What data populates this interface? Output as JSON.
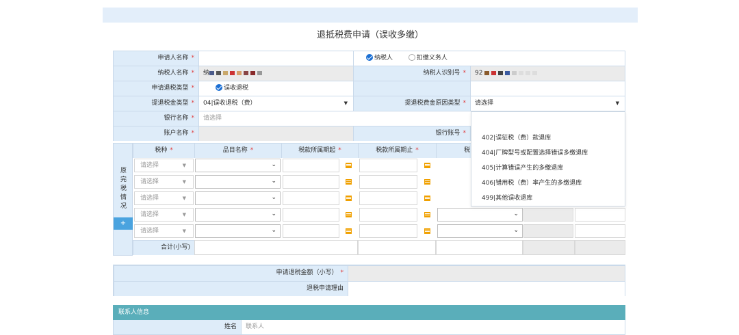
{
  "page_title": "退抵税费申请（误收多缴）",
  "form": {
    "applicant_name_label": "申请人名称",
    "applicant_type_options": [
      "纳税人",
      "扣缴义务人"
    ],
    "taxpayer_name_label": "纳税人名称",
    "taxpayer_name_masked": "纳",
    "taxpayer_id_label": "纳税人识别号",
    "taxpayer_id_masked": "92",
    "refund_type_label": "申请退税类型",
    "refund_type_value": "误收退税",
    "amount_type_label": "提退税金类型",
    "amount_type_value": "04|误收退税（费）",
    "reason_type_label": "提退税费金原因类型",
    "reason_type_value": "请选择",
    "bank_name_label": "银行名称",
    "bank_name_placeholder": "请选择",
    "account_name_label": "账户名称",
    "bank_account_label": "银行账号",
    "required_mark": "*"
  },
  "reason_dropdown": {
    "options": [
      "402|误征税（费）款退库",
      "404|厂牌型号或配置选择错误多缴退库",
      "405|计算错误产生的多缴退库",
      "406|错用税（费）率产生的多缴退库",
      "499|其他误收退库"
    ]
  },
  "tax_table": {
    "side_label": [
      "原",
      "完",
      "税",
      "情",
      "况"
    ],
    "add_button": "+",
    "headers": [
      "税种",
      "品目名称",
      "税款所属期起",
      "税款所属期止",
      "税"
    ],
    "row_placeholder": "请选择",
    "row_count": 5,
    "total_label": "合计(小写)"
  },
  "summary": {
    "refund_amount_label": "申请退税金额（小写）",
    "reason_label": "退税申请理由"
  },
  "contact": {
    "section_title": "联系人信息",
    "name_label": "姓名",
    "name_placeholder": "联系人"
  },
  "colors": {
    "header_bg": "#deecf9",
    "readonly_bg": "#ebebeb",
    "accent": "#1b6fd4",
    "section_header": "#5aaeba",
    "calendar_icon": "#f0a000"
  }
}
